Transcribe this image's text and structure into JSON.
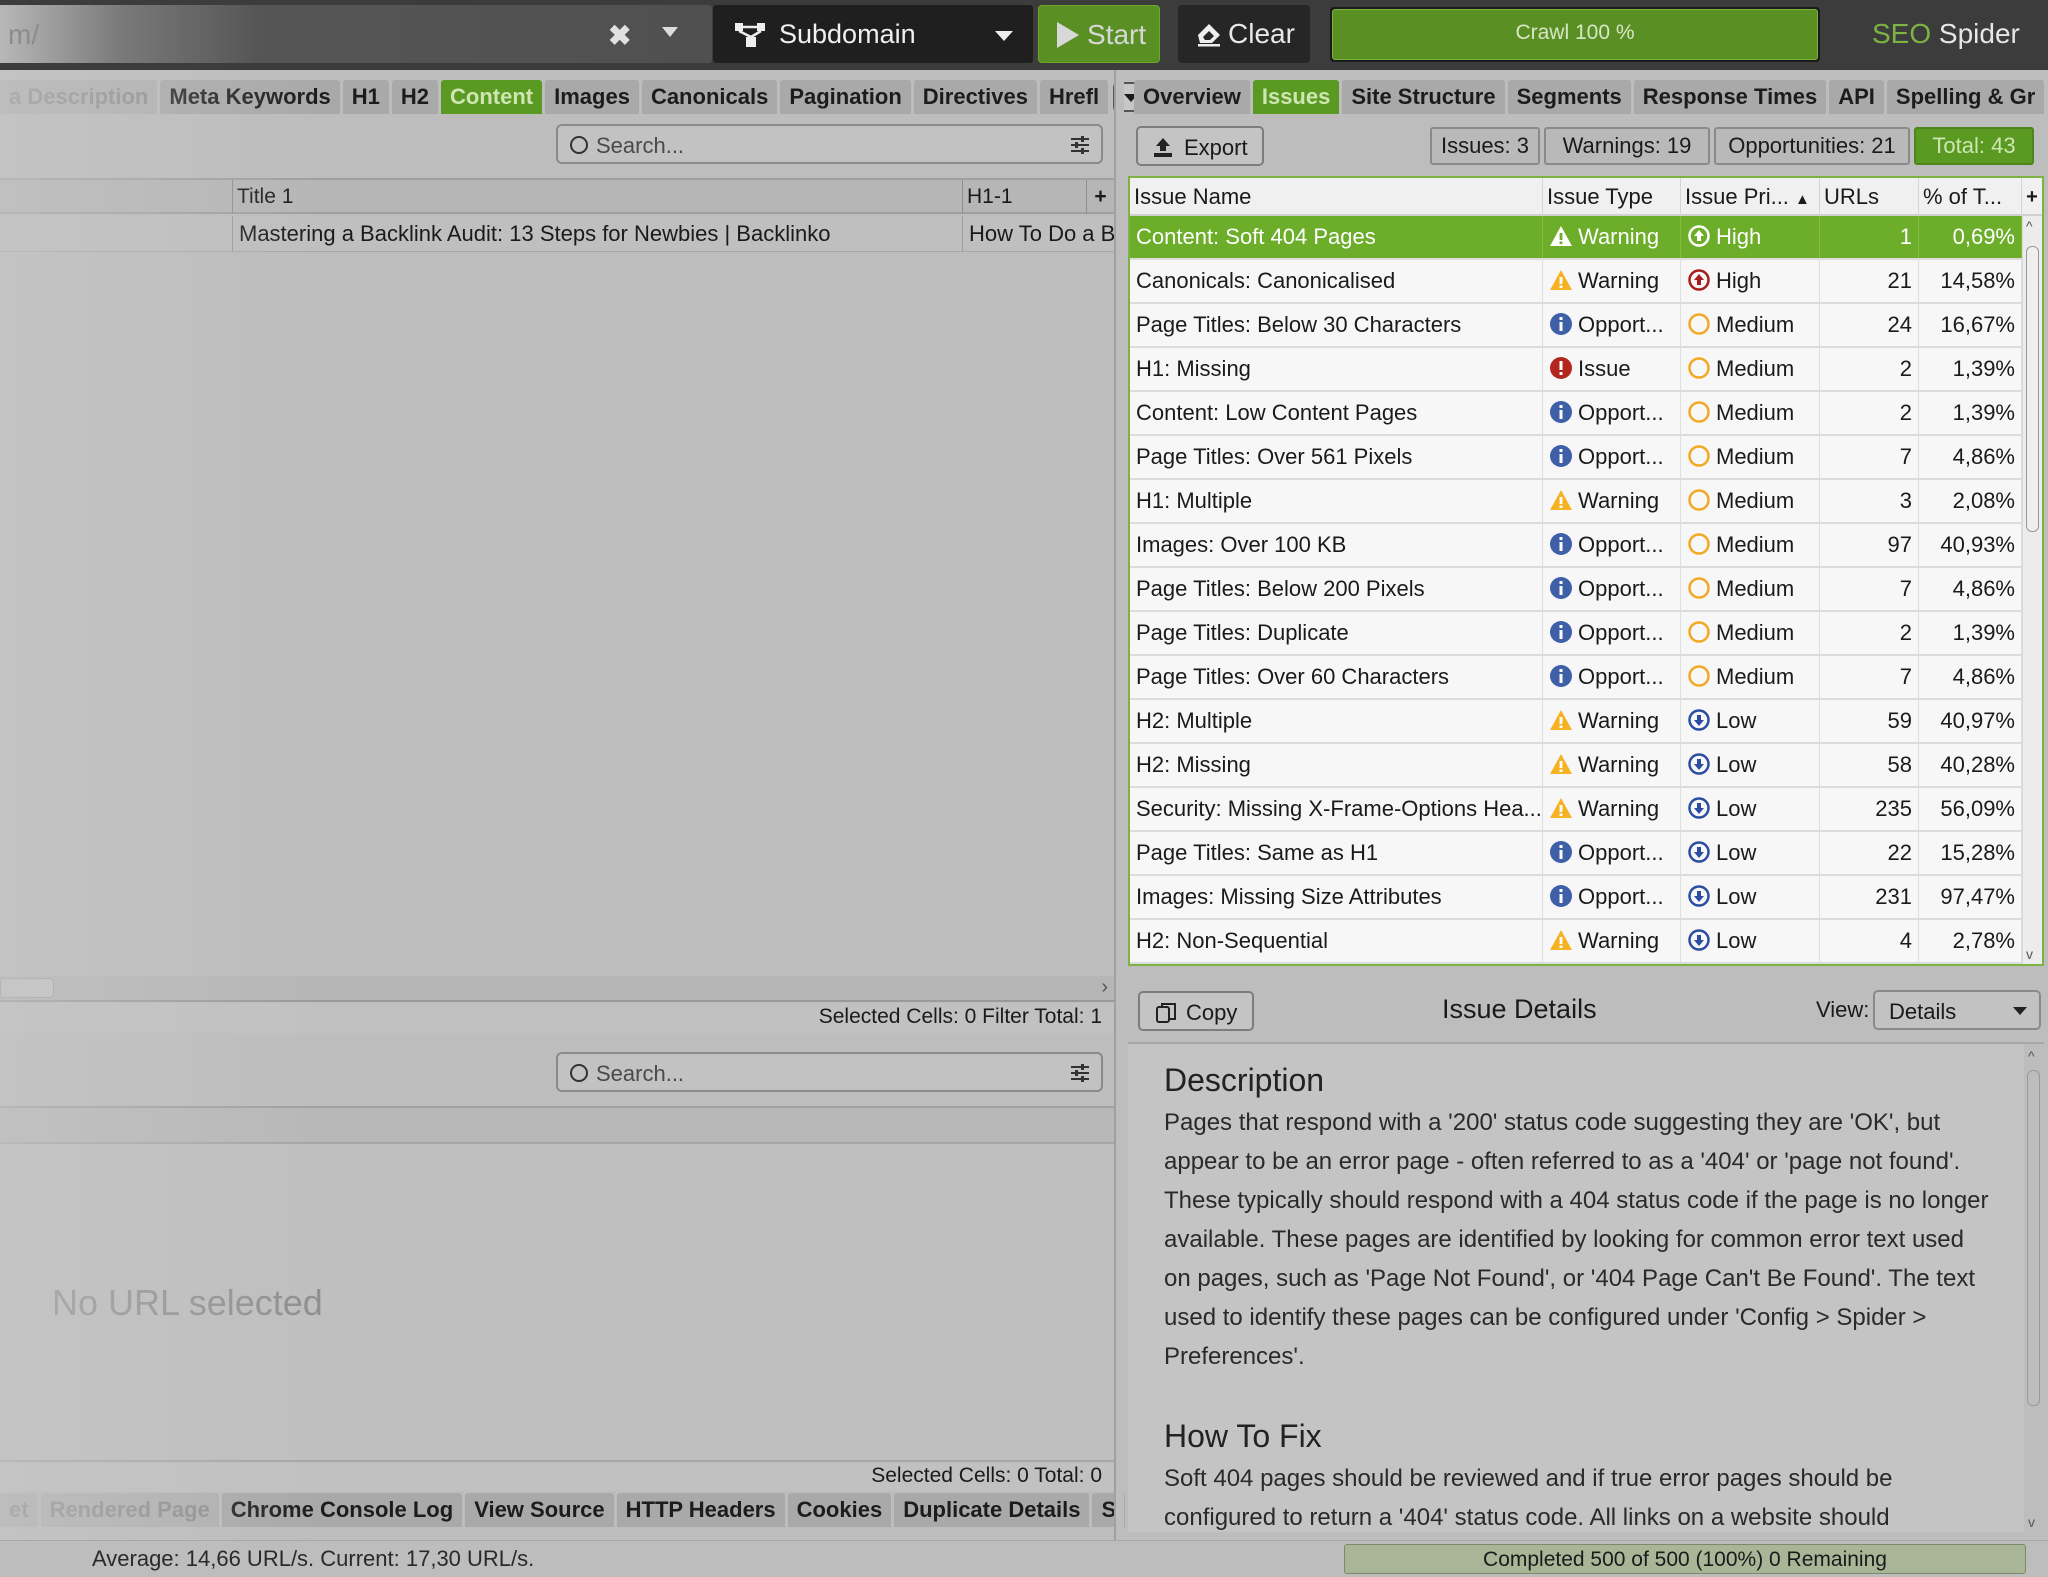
{
  "toolbar": {
    "url_text": "m/",
    "clear_url_glyph": "✖",
    "mode_label": "Subdomain",
    "mode_icon": "site-structure-icon",
    "start_label": "Start",
    "clear_label": "Clear",
    "crawl_label": "Crawl 100 %",
    "crawl_progress_pct": 100,
    "brand_seo": "SEO",
    "brand_spider": " Spider"
  },
  "left_tabs": [
    {
      "label": "a Description",
      "state": "faded"
    },
    {
      "label": "Meta Keywords",
      "state": "normal"
    },
    {
      "label": "H1",
      "state": "normal"
    },
    {
      "label": "H2",
      "state": "normal"
    },
    {
      "label": "Content",
      "state": "active"
    },
    {
      "label": "Images",
      "state": "normal"
    },
    {
      "label": "Canonicals",
      "state": "normal"
    },
    {
      "label": "Pagination",
      "state": "normal"
    },
    {
      "label": "Directives",
      "state": "normal"
    },
    {
      "label": "Hrefl",
      "state": "normal"
    }
  ],
  "right_tabs": [
    {
      "label": "Overview",
      "state": "normal"
    },
    {
      "label": "Issues",
      "state": "active"
    },
    {
      "label": "Site Structure",
      "state": "normal"
    },
    {
      "label": "Segments",
      "state": "normal"
    },
    {
      "label": "Response Times",
      "state": "normal"
    },
    {
      "label": "API",
      "state": "normal"
    },
    {
      "label": "Spelling & Gr",
      "state": "normal"
    }
  ],
  "upper_grid": {
    "search_placeholder": "Search...",
    "columns": [
      "Title 1",
      "H1-1"
    ],
    "add_column_glyph": "+",
    "rows": [
      {
        "title_1": "Mastering a Backlink Audit: 13 Steps for Newbies | Backlinko",
        "h1_1": "How To Do a B"
      }
    ],
    "status": "Selected Cells:  0  Filter Total:  1"
  },
  "lower_pane": {
    "search_placeholder": "Search...",
    "empty_message": "No URL selected",
    "status": "Selected Cells:  0  Total:  0",
    "tabs": [
      {
        "label": "et",
        "state": "faded"
      },
      {
        "label": "Rendered Page",
        "state": "faded"
      },
      {
        "label": "Chrome Console Log",
        "state": "normal"
      },
      {
        "label": "View Source",
        "state": "normal"
      },
      {
        "label": "HTTP Headers",
        "state": "normal"
      },
      {
        "label": "Cookies",
        "state": "normal"
      },
      {
        "label": "Duplicate Details",
        "state": "normal"
      },
      {
        "label": "S",
        "state": "normal"
      }
    ]
  },
  "issues": {
    "export_label": "Export",
    "badges": {
      "issues": "Issues: 3",
      "warnings": "Warnings: 19",
      "opportunities": "Opportunities: 21",
      "total": "Total: 43"
    },
    "columns": {
      "name": "Issue Name",
      "type": "Issue Type",
      "priority": "Issue Pri...",
      "urls": "URLs",
      "pct": "% of T...",
      "add": "+"
    },
    "sort_indicator": "▲",
    "selected_index": 0,
    "rows": [
      {
        "name": "Content: Soft 404 Pages",
        "type": "Warning",
        "priority": "High",
        "urls": "1",
        "pct": "0,69%"
      },
      {
        "name": "Canonicals: Canonicalised",
        "type": "Warning",
        "priority": "High",
        "urls": "21",
        "pct": "14,58%"
      },
      {
        "name": "Page Titles: Below 30 Characters",
        "type": "Opport...",
        "priority": "Medium",
        "urls": "24",
        "pct": "16,67%"
      },
      {
        "name": "H1: Missing",
        "type": "Issue",
        "priority": "Medium",
        "urls": "2",
        "pct": "1,39%"
      },
      {
        "name": "Content: Low Content Pages",
        "type": "Opport...",
        "priority": "Medium",
        "urls": "2",
        "pct": "1,39%"
      },
      {
        "name": "Page Titles: Over 561 Pixels",
        "type": "Opport...",
        "priority": "Medium",
        "urls": "7",
        "pct": "4,86%"
      },
      {
        "name": "H1: Multiple",
        "type": "Warning",
        "priority": "Medium",
        "urls": "3",
        "pct": "2,08%"
      },
      {
        "name": "Images: Over 100 KB",
        "type": "Opport...",
        "priority": "Medium",
        "urls": "97",
        "pct": "40,93%"
      },
      {
        "name": "Page Titles: Below 200 Pixels",
        "type": "Opport...",
        "priority": "Medium",
        "urls": "7",
        "pct": "4,86%"
      },
      {
        "name": "Page Titles: Duplicate",
        "type": "Opport...",
        "priority": "Medium",
        "urls": "2",
        "pct": "1,39%"
      },
      {
        "name": "Page Titles: Over 60 Characters",
        "type": "Opport...",
        "priority": "Medium",
        "urls": "7",
        "pct": "4,86%"
      },
      {
        "name": "H2: Multiple",
        "type": "Warning",
        "priority": "Low",
        "urls": "59",
        "pct": "40,97%"
      },
      {
        "name": "H2: Missing",
        "type": "Warning",
        "priority": "Low",
        "urls": "58",
        "pct": "40,28%"
      },
      {
        "name": "Security: Missing X-Frame-Options Hea...",
        "type": "Warning",
        "priority": "Low",
        "urls": "235",
        "pct": "56,09%"
      },
      {
        "name": "Page Titles: Same as H1",
        "type": "Opport...",
        "priority": "Low",
        "urls": "22",
        "pct": "15,28%"
      },
      {
        "name": "Images: Missing Size Attributes",
        "type": "Opport...",
        "priority": "Low",
        "urls": "231",
        "pct": "97,47%"
      },
      {
        "name": "H2: Non-Sequential",
        "type": "Warning",
        "priority": "Low",
        "urls": "4",
        "pct": "2,78%"
      }
    ]
  },
  "details": {
    "copy_label": "Copy",
    "title": "Issue Details",
    "view_label": "View:",
    "view_value": "Details",
    "description_heading": "Description",
    "description_text": "Pages that respond with a '200' status code suggesting they are 'OK', but appear to be an error page - often referred to as a '404' or 'page not found'. These typically should respond with a 404 status code if the page is no longer available. These pages are identified by looking for common error text used on pages, such as 'Page Not Found', or '404 Page Can't Be Found'. The text used to identify these pages can be configured under 'Config > Spider > Preferences'.",
    "howto_heading": "How To Fix",
    "howto_text": "Soft 404 pages should be reviewed and if true error pages should be configured to return a '404' status code. All links on a website should"
  },
  "status_bar": {
    "speed_text": "Average: 14,66 URL/s. Current: 17,30 URL/s.",
    "completion_text": "Completed 500 of 500 (100%) 0 Remaining"
  },
  "colors": {
    "accent_green": "#5a9a22",
    "selected_row": "#6cad2a",
    "warning": "#f5b324",
    "issue": "#b3261e",
    "opportunity": "#3f5fa8",
    "priority_high": "#a71d1d",
    "priority_medium": "#f2a825",
    "priority_low": "#2a4da0"
  }
}
